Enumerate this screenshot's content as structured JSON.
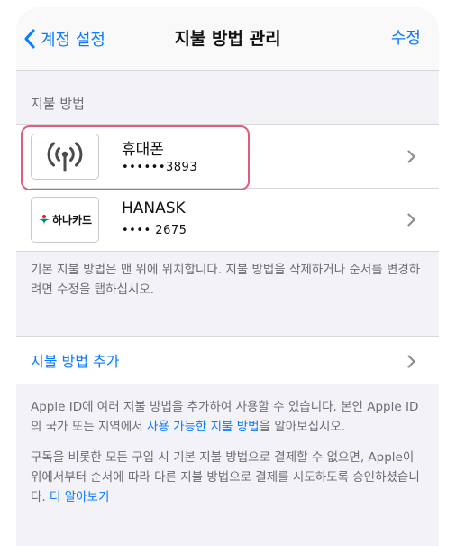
{
  "nav": {
    "back_label": "계정 설정",
    "title": "지불 방법 관리",
    "edit_label": "수정"
  },
  "payment_section": {
    "header": "지불 방법",
    "methods": [
      {
        "title": "휴대폰",
        "subtitle": "••••••3893",
        "icon": "cellular-antenna-icon"
      },
      {
        "title": "HANASK",
        "subtitle": "•••• 2675",
        "icon": "hana-card-logo",
        "logo_text": "하나카드",
        "brand_color": "#00857a"
      }
    ],
    "note": "기본 지불 방법은 맨 위에 위치합니다. 지불 방법을 삭제하거나 순서를 변경하려면 수정을 탭하십시오."
  },
  "add_section": {
    "label": "지불 방법 추가"
  },
  "info": {
    "p1_before": "Apple ID에 여러 지불 방법을 추가하여 사용할 수 있습니다. 본인 Apple ID의 국가 또는 지역에서 ",
    "p1_link": "사용 가능한 지불 방법",
    "p1_after": "을 알아보십시오.",
    "p2_before": "구독을 비롯한 모든 구입 시 기본 지불 방법으로 결제할 수 없으면, Apple이 위에서부터 순서에 따라 다른 지불 방법으로 결제를 시도하도록 승인하셨습니다. ",
    "p2_link": "더 알아보기"
  },
  "colors": {
    "accent": "#0a7aff",
    "highlight": "#e05d7d",
    "background": "#f2f2f7"
  }
}
